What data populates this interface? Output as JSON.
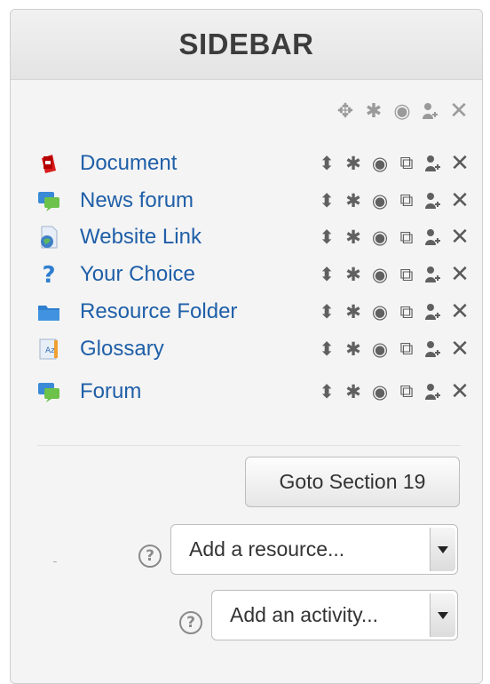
{
  "header": {
    "title": "SIDEBAR"
  },
  "block_controls": [
    "move-icon",
    "gear-icon",
    "eye-icon",
    "assign-role-icon",
    "close-icon"
  ],
  "glyphs": {
    "move": "✥",
    "gear": "✱",
    "eye": "◉",
    "duplicate": "⧉",
    "role": "⚲",
    "delete": "✕",
    "updown": "⬍"
  },
  "items": [
    {
      "label": "Document",
      "icon": "pdf-icon"
    },
    {
      "label": "News forum",
      "icon": "forum-icon"
    },
    {
      "label": "Website Link",
      "icon": "url-icon"
    },
    {
      "label": "Your Choice",
      "icon": "question-icon"
    },
    {
      "label": "Resource Folder",
      "icon": "folder-icon"
    },
    {
      "label": "Glossary",
      "icon": "glossary-icon"
    },
    {
      "label": "Forum",
      "icon": "forum-icon"
    }
  ],
  "goto_button": {
    "label": "Goto Section 19"
  },
  "add_resource": {
    "selected": "Add a resource..."
  },
  "add_activity": {
    "selected": "Add an activity..."
  },
  "colors": {
    "link": "#1f5fa8",
    "header_text": "#3c3c3c"
  }
}
